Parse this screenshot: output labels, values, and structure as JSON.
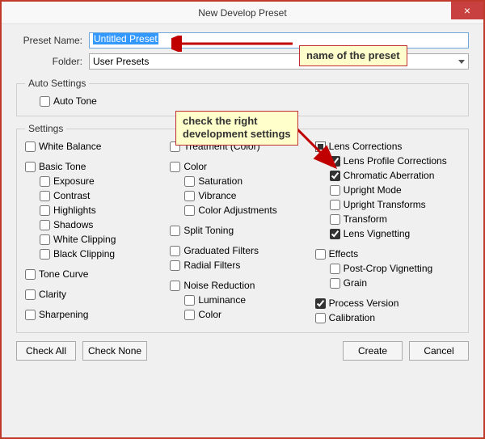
{
  "window": {
    "title": "New Develop Preset"
  },
  "form": {
    "preset_name_label": "Preset Name:",
    "preset_name_value": "Untitled Preset",
    "folder_label": "Folder:",
    "folder_value": "User Presets"
  },
  "auto_settings": {
    "legend": "Auto Settings",
    "auto_tone": "Auto Tone"
  },
  "settings": {
    "legend": "Settings",
    "col1": {
      "white_balance": "White Balance",
      "basic_tone": "Basic Tone",
      "exposure": "Exposure",
      "contrast": "Contrast",
      "highlights": "Highlights",
      "shadows": "Shadows",
      "white_clipping": "White Clipping",
      "black_clipping": "Black Clipping",
      "tone_curve": "Tone Curve",
      "clarity": "Clarity",
      "sharpening": "Sharpening"
    },
    "col2": {
      "treatment": "Treatment (Color)",
      "color": "Color",
      "saturation": "Saturation",
      "vibrance": "Vibrance",
      "color_adjustments": "Color Adjustments",
      "split_toning": "Split Toning",
      "graduated_filters": "Graduated Filters",
      "radial_filters": "Radial Filters",
      "noise_reduction": "Noise Reduction",
      "luminance": "Luminance",
      "noise_color": "Color"
    },
    "col3": {
      "lens_corrections": "Lens Corrections",
      "lens_profile": "Lens Profile Corrections",
      "chromatic_aberration": "Chromatic Aberration",
      "upright_mode": "Upright Mode",
      "upright_transforms": "Upright Transforms",
      "transform": "Transform",
      "lens_vignetting": "Lens Vignetting",
      "effects": "Effects",
      "post_crop_vignetting": "Post-Crop Vignetting",
      "grain": "Grain",
      "process_version": "Process Version",
      "calibration": "Calibration"
    }
  },
  "buttons": {
    "check_all": "Check All",
    "check_none": "Check None",
    "create": "Create",
    "cancel": "Cancel"
  },
  "annotations": {
    "name_callout": "name of the preset",
    "settings_callout": "check the right\ndevelopment settings"
  },
  "checked": {
    "lens_profile": true,
    "chromatic_aberration": true,
    "lens_vignetting": true,
    "process_version": true
  }
}
